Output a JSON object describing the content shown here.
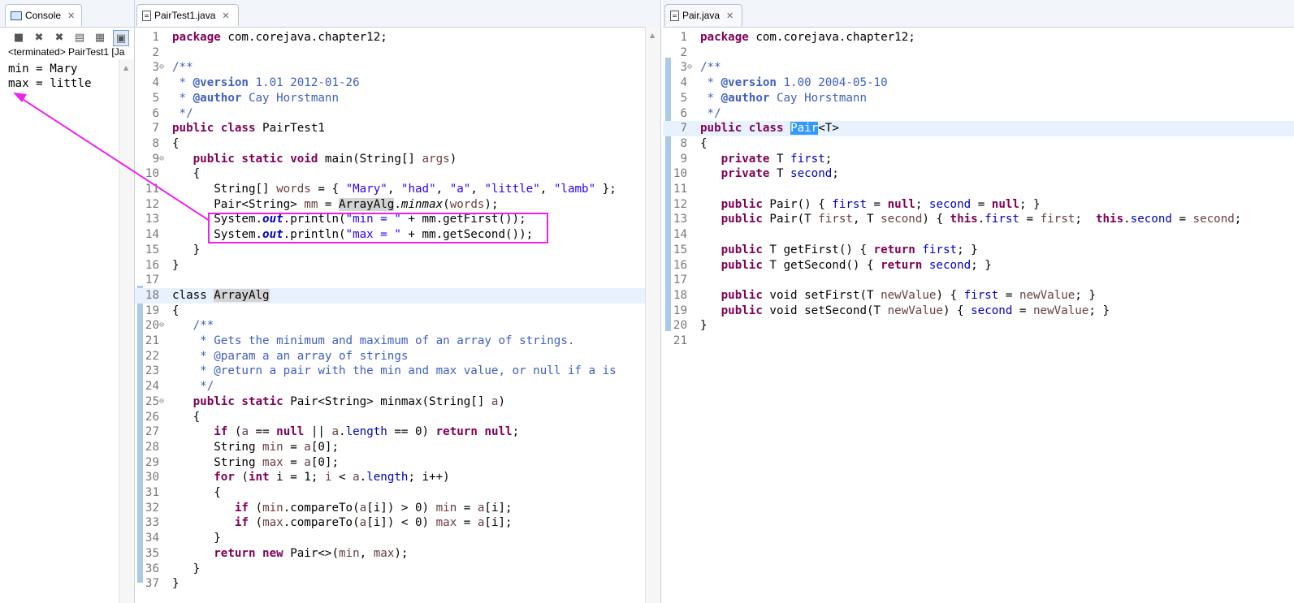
{
  "console": {
    "tab_label": "Console",
    "terminated": "<terminated> PairTest1 [Ja",
    "output": [
      "min = Mary",
      "max = little"
    ]
  },
  "editor_left": {
    "tab_label": "PairTest1.java",
    "line_numbers": [
      "1",
      "2",
      "3",
      "4",
      "5",
      "6",
      "7",
      "8",
      "9",
      "10",
      "11",
      "12",
      "13",
      "14",
      "15",
      "16",
      "17",
      "18",
      "19",
      "20",
      "21",
      "22",
      "23",
      "24",
      "25",
      "26",
      "27",
      "28",
      "29",
      "30",
      "31",
      "32",
      "33",
      "34",
      "35",
      "36",
      "37"
    ]
  },
  "editor_right": {
    "tab_label": "Pair.java",
    "line_numbers": [
      "1",
      "2",
      "3",
      "4",
      "5",
      "6",
      "7",
      "8",
      "9",
      "10",
      "11",
      "12",
      "13",
      "14",
      "15",
      "16",
      "17",
      "18",
      "19",
      "20",
      "21"
    ]
  },
  "code": {
    "t": {
      "package": "package",
      "public": "public",
      "class": "class",
      "static": "static",
      "void": "void",
      "private": "private",
      "null": "null",
      "this": "this",
      "return": "return",
      "if": "if",
      "for": "for",
      "int": "int",
      "new": "new",
      "pkg": " com.corejava.chapter12;",
      "jd_open": "/**",
      "jd_close": " */",
      "jd_close2": "    */",
      "jd_star": " * ",
      "at_version": "@version",
      "at_author": "@author",
      "version_left": " 1.01 2012-01-26",
      "version_right": " 1.00 2004-05-10",
      "cay": "Cay",
      "horstmann": "Horstmann",
      "PairTest1": " PairTest1",
      "lbrace": "{",
      "rbrace": "}",
      "main": " main(String[] ",
      "args": "args",
      "rparen": ")",
      "l11a": "      String[] ",
      "words": "words",
      "l11b": " = { ",
      "s_mary": "\"Mary\"",
      "s_had": "\"had\"",
      "s_a": "\"a\"",
      "s_little": "\"little\"",
      "s_lamb": "\"lamb\"",
      "comma": ", ",
      "l11c": " };",
      "l12a": "      Pair<String> ",
      "mm": "mm",
      "eq": " = ",
      "ArrayAlg": "ArrayAlg",
      "dot": ".",
      "minmax_it": "minmax",
      "lparen": "(",
      "endcall": ");",
      "sys": "      System.",
      "out": "out",
      "println": ".println(",
      "s_min": "\"min = \"",
      "s_max": "\"max = \"",
      "getFirst": " + mm.getFirst());",
      "getSecond": " + mm.getSecond());",
      "cls": "class ",
      "c_gets": "    * Gets the minimum and maximum of an array of strings.",
      "c_param": "    * @param a an array of strings",
      "c_ret_a": "    * @return a pair with the ",
      "c_min": "min",
      "c_ret_b": " and max value, or null if a is",
      "minmax_decl": " Pair<String> minmax(String[] ",
      "a": "a",
      "l27a": " (",
      "l27b": " == ",
      "l27c": " || ",
      "length": "length",
      "l27d": " == 0) ",
      "semi": ";",
      "strSp": "      String ",
      "min": "min",
      "max": "max",
      "a0": "[0];",
      "forParen": " (",
      "intSp": " i = 1; ",
      "i": "i",
      "lt": " < ",
      "ipp": "; i++)",
      "l32b": ".compareTo(",
      "l32c": "[i]) > 0) ",
      "l33c": "[i]) < 0) ",
      "ai": "[i];",
      "newPair": " Pair<>(",
      "cm": ", ",
      "T": "T",
      "Pair": "Pair",
      "Tgen": "<T>",
      "first": "first",
      "second": "second",
      "Tsp": " T ",
      "pairCtor": " Pair() { ",
      "pairCtor2": " Pair(T ",
      "ctorMid": ", T ",
      "ctorBody": ") { ",
      "semiSp": "; ",
      "closeBr": "; }",
      "eqnull": " = ",
      "getFirstD": " T getFirst() { ",
      "getSecondD": " T getSecond() { ",
      "setFirstD": " void setFirst(T ",
      "setSecondD": " void setSecond(T ",
      "newValue": "newValue",
      "setBody": ") { ",
      "semiD": ";",
      "indent": "   ",
      "indent2": "      ",
      "indent3": "         ",
      "sp": " "
    }
  },
  "colors": {
    "callout": "#ee22ee",
    "keyword": "#7f0055",
    "string": "#2a00ff",
    "field": "#0000c0",
    "javadoc": "#3f5fbf"
  }
}
